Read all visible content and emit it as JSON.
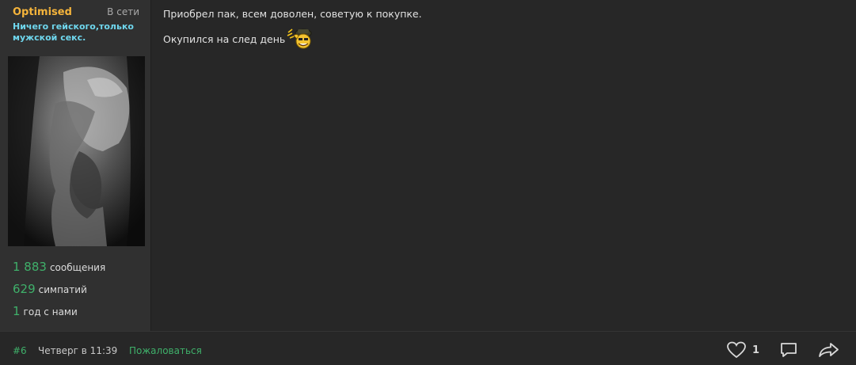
{
  "user": {
    "name": "Optimised",
    "status": "В сети",
    "title": "Ничего гейского,только мужской секс.",
    "stats": [
      {
        "value": "1 883",
        "label": "сообщения"
      },
      {
        "value": "629",
        "label": "симпатий"
      },
      {
        "value": "1",
        "label": "год с нами"
      }
    ]
  },
  "post": {
    "line1": "Приобрел пак, всем доволен, советую к покупке.",
    "line2": "Окупился на след день",
    "emoji_icon": "salute-smiley-icon"
  },
  "footer": {
    "post_number": "#6",
    "date": "Четверг в 11:39",
    "report_label": "Пожаловаться",
    "like_count": "1"
  },
  "colors": {
    "username": "#f5b43b",
    "user_title": "#6fd7ee",
    "accent_green": "#3fb06a",
    "background": "#272727",
    "user_panel": "#303030"
  }
}
